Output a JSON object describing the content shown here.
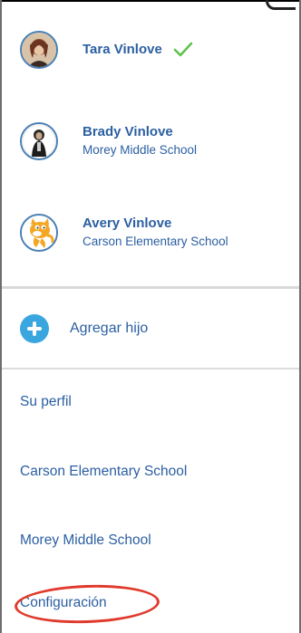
{
  "profiles": [
    {
      "name": "Tara Vinlove",
      "school": "",
      "selected": true
    },
    {
      "name": "Brady Vinlove",
      "school": "Morey Middle School",
      "selected": false
    },
    {
      "name": "Avery Vinlove",
      "school": "Carson Elementary School",
      "selected": false
    }
  ],
  "add_child": {
    "label": "Agregar hijo"
  },
  "menu": {
    "profile_label": "Su perfil",
    "school_1": "Carson Elementary School",
    "school_2": "Morey Middle School",
    "settings_label": "Configuración"
  },
  "colors": {
    "link": "#2b5fa1",
    "check": "#5cc24a",
    "add_button": "#3aa6e0",
    "annotation": "#e03a2c",
    "divider": "#d9d9d9"
  },
  "icons": {
    "selected_marker": "checkmark-icon",
    "add": "plus-circle-icon"
  }
}
